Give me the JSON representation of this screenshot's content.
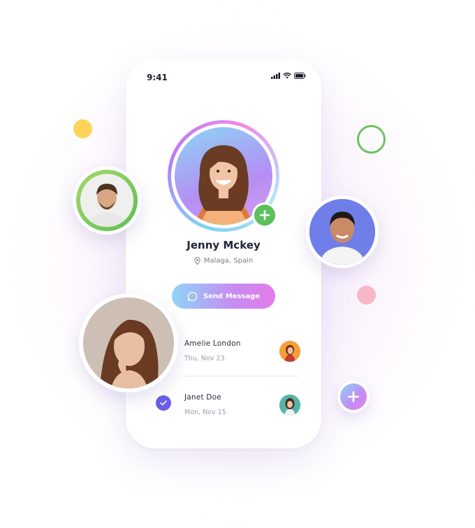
{
  "status_bar": {
    "time": "9:41"
  },
  "profile": {
    "name": "Jenny Mckey",
    "location": "Malaga, Spain"
  },
  "actions": {
    "send_message_label": "Send Message"
  },
  "messages": [
    {
      "name": "Amelie London",
      "date": "Thu, Nov 23"
    },
    {
      "name": "Janet Doe",
      "date": "Mon, Nov 15"
    }
  ],
  "colors": {
    "add_green": "#5cc05b",
    "check_purple": "#6a5cec",
    "dot_yellow": "#fdd35a",
    "ring_green": "#6cc35a",
    "dot_pink": "#f7b7c6"
  }
}
